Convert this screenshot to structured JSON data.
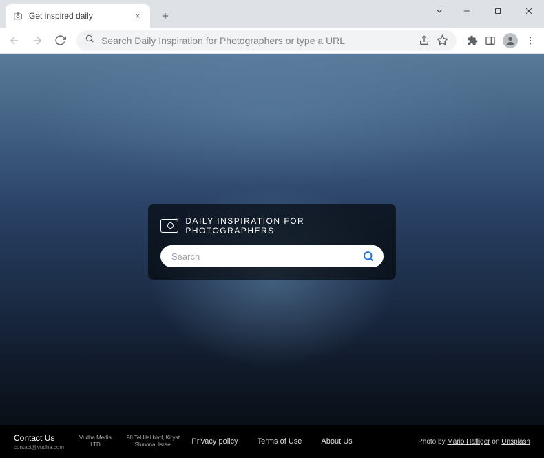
{
  "window": {
    "tab_title": "Get inspired daily"
  },
  "toolbar": {
    "omnibox_placeholder": "Search Daily Inspiration for Photographers or type a URL"
  },
  "page": {
    "brand_title": "DAILY INSPIRATION FOR PHOTOGRAPHERS",
    "search_placeholder": "Search"
  },
  "footer": {
    "contact_label": "Contact Us",
    "contact_email": "contact@vudha.com",
    "company_line1": "Vudha Media",
    "company_line2": "LTD",
    "address_line1": "98 Tel Hai blvd, Kiryat",
    "address_line2": "Shmona, Israel",
    "links": {
      "privacy": "Privacy policy",
      "terms": "Terms of Use",
      "about": "About Us"
    },
    "credit_prefix": "Photo by ",
    "credit_author": "Mario Häfliger",
    "credit_on": " on ",
    "credit_source": "Unsplash"
  }
}
